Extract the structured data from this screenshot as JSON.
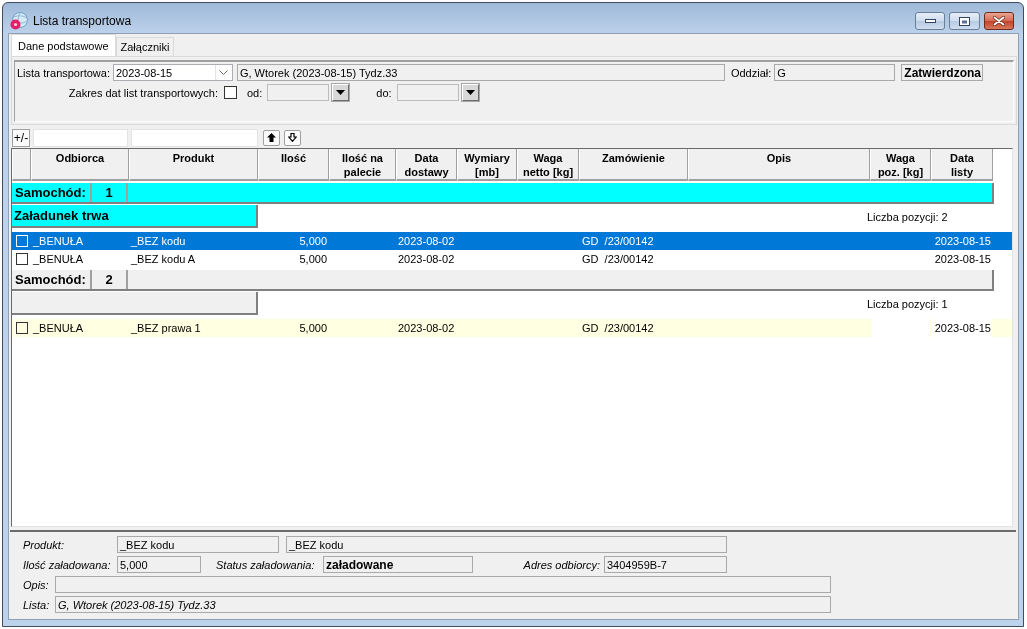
{
  "window": {
    "title": "Lista transportowa"
  },
  "tabs": [
    {
      "label": "Dane podstawowe",
      "selected": true
    },
    {
      "label": "Załączniki",
      "selected": false
    }
  ],
  "header": {
    "list_label": "Lista transportowa:",
    "list_value": "2023-08-15",
    "list_description": "G, Wtorek (2023-08-15) Tydz.33",
    "branch_label": "Oddział:",
    "branch_value": "G",
    "status": "Zatwierdzona",
    "date_range": {
      "label": "Zakres dat list transportowych:",
      "checked": false,
      "from_label": "od:",
      "to_label": "do:"
    }
  },
  "toolbar": {
    "toggle_label": "+/-"
  },
  "table": {
    "columns": [
      "Odbiorca",
      "Produkt",
      "Ilość",
      "Ilość na palecie",
      "Data dostawy",
      "Wymiary [mb]",
      "Waga netto [kg]",
      "Zamówienie",
      "Opis",
      "Waga poz. [kg]",
      "Data listy"
    ],
    "groups": [
      {
        "label": "Samochód:",
        "number": "1",
        "color": "#00ffff",
        "status": "Załadunek trwa",
        "count": "Liczba pozycji: 2",
        "rows": [
          {
            "checked": false,
            "selected": true,
            "highlighted": false,
            "recipient": "_BENUŁA",
            "product": "_BEZ kodu",
            "quantity": "5,000",
            "delivery_date": "2023-08-02",
            "order": "GD  /23/00142",
            "list_date": "2023-08-15"
          },
          {
            "checked": false,
            "selected": false,
            "highlighted": false,
            "recipient": "_BENUŁA",
            "product": "_BEZ kodu A",
            "quantity": "5,000",
            "delivery_date": "2023-08-02",
            "order": "GD  /23/00142",
            "list_date": "2023-08-15"
          }
        ]
      },
      {
        "label": "Samochód:",
        "number": "2",
        "color": "#f0f0f0",
        "count": "Liczba pozycji: 1",
        "rows": [
          {
            "checked": false,
            "selected": false,
            "highlighted": true,
            "recipient": "_BENUŁA",
            "product": "_BEZ prawa 1",
            "quantity": "5,000",
            "delivery_date": "2023-08-02",
            "order": "GD  /23/00142",
            "list_date": "2023-08-15"
          }
        ]
      }
    ]
  },
  "details": {
    "product_label": "Produkt:",
    "product_code": "_BEZ kodu",
    "product_name": "_BEZ kodu",
    "loaded_quantity_label": "Ilość załadowana:",
    "loaded_quantity": "5,000",
    "load_status_label": "Status załadowania:",
    "load_status": "załadowane",
    "address_label": "Adres odbiorcy:",
    "address": "3404959B-7",
    "description_label": "Opis:",
    "list_label": "Lista:",
    "list_value": "G, Wtorek (2023-08-15) Tydz.33"
  }
}
